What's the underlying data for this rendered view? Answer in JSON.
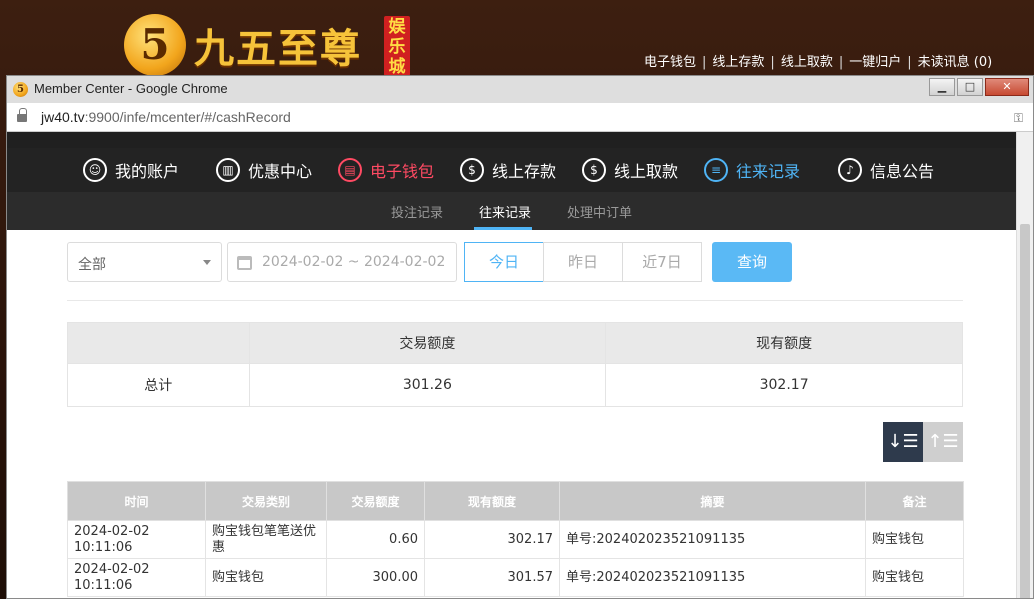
{
  "site": {
    "logo_char": "5",
    "logo_text": "九五至尊",
    "logo_tag": "娱乐城",
    "top_links": [
      "电子钱包",
      "线上存款",
      "线上取款",
      "一键归户",
      "未读讯息 (0)"
    ]
  },
  "window": {
    "title": "Member Center - Google Chrome",
    "url_host": "jw40.tv",
    "url_rest": ":9900/infe/mcenter/#/cashRecord",
    "btn_min": "▁",
    "btn_max": "□",
    "btn_close": "✕"
  },
  "nav": {
    "items": [
      {
        "label": "我的账户",
        "icon": "user-icon"
      },
      {
        "label": "优惠中心",
        "icon": "gift-icon"
      },
      {
        "label": "电子钱包",
        "icon": "wallet-icon"
      },
      {
        "label": "线上存款",
        "icon": "deposit-icon"
      },
      {
        "label": "线上取款",
        "icon": "withdraw-icon"
      },
      {
        "label": "往来记录",
        "icon": "record-icon"
      },
      {
        "label": "信息公告",
        "icon": "bell-icon"
      }
    ],
    "sub": [
      "投注记录",
      "往来记录",
      "处理中订单"
    ]
  },
  "filters": {
    "type_value": "全部",
    "date_range": "2024-02-02 ~ 2024-02-02",
    "quick": [
      "今日",
      "昨日",
      "近7日"
    ],
    "search_label": "查询"
  },
  "summary": {
    "headers": [
      "",
      "交易额度",
      "现有额度"
    ],
    "row_label": "总计",
    "amount": "301.26",
    "balance": "302.17"
  },
  "sort": {
    "desc": "↓☰",
    "asc": "↑☰"
  },
  "records": {
    "headers": [
      "时间",
      "交易类别",
      "交易额度",
      "现有额度",
      "摘要",
      "备注"
    ],
    "rows": [
      {
        "time": "2024-02-02 10:11:06",
        "type": "购宝钱包笔笔送优惠",
        "amount": "0.60",
        "balance": "302.17",
        "summary": "单号:202402023521091135",
        "note": "购宝钱包"
      },
      {
        "time": "2024-02-02 10:11:06",
        "type": "购宝钱包",
        "amount": "300.00",
        "balance": "301.57",
        "summary": "单号:202402023521091135",
        "note": "购宝钱包"
      }
    ]
  },
  "colors": {
    "accent_blue": "#4fb4f5",
    "accent_red": "#ff4a63",
    "nav_bg": "#232323"
  }
}
